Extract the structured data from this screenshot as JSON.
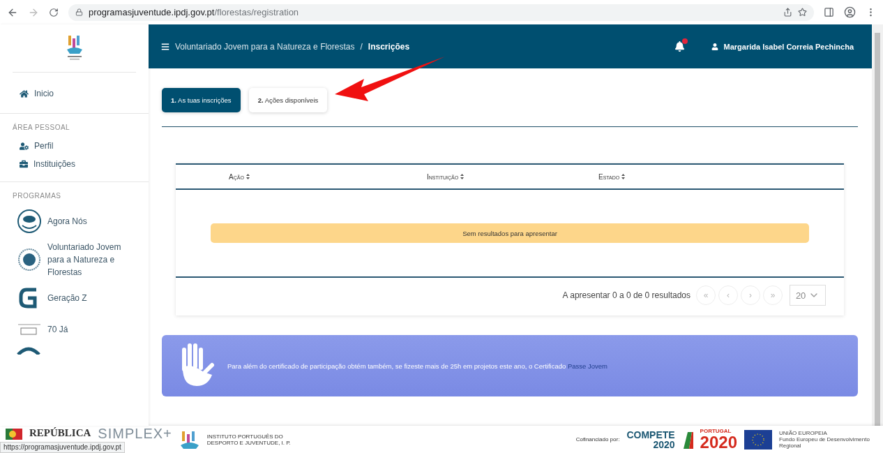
{
  "browser": {
    "url_host": "programasjuventude.ipdj.gov.pt",
    "url_path": "/florestas/registration"
  },
  "sidebar": {
    "home": {
      "label": "Inicio"
    },
    "sections": [
      {
        "title": "ÁREA PESSOAL",
        "items": [
          {
            "label": "Perfil",
            "kind": "profile"
          },
          {
            "label": "Instituições",
            "kind": "briefcase"
          }
        ]
      },
      {
        "title": "PROGRAMAS",
        "items": [
          {
            "label": "Agora Nós",
            "kind": "nos"
          },
          {
            "label": "Voluntariado Jovem para a Natureza e Florestas",
            "kind": "vjnf"
          },
          {
            "label": "Geração Z",
            "kind": "geracao"
          },
          {
            "label": "70 Já",
            "kind": "setenta"
          }
        ]
      }
    ]
  },
  "header": {
    "separator": "/",
    "breadcrumb": [
      {
        "label": "Voluntariado Jovem para a Natureza e Florestas",
        "current": false
      },
      {
        "label": "Inscrições",
        "current": true
      }
    ],
    "user": "Margarida Isabel Correia Pechincha"
  },
  "tabs": [
    {
      "number": "1.",
      "label": "As tuas inscrições",
      "selected": true
    },
    {
      "number": "2.",
      "label": "Ações disponíveis",
      "selected": false
    }
  ],
  "table": {
    "columns": [
      "Ação",
      "Instituição",
      "Estado"
    ],
    "empty_message": "Sem resultados para apresentar",
    "summary": "A apresentar 0 a 0 de 0 resultados",
    "pager": [
      "«",
      "‹",
      "›",
      "»"
    ],
    "page_size": "20"
  },
  "banner": {
    "text": "Para além do certificado de participação obtém também, se fizeste mais de 25h em projetos este ano, o Certificado",
    "link": "Passe Jovem"
  },
  "footer": {
    "republica": "REPÚBLICA",
    "simplex": "SIMPLEX+",
    "ipdj": "INSTITUTO PORTUGUÊS DO DESPORTO E JUVENTUDE, I. P.",
    "cofinanciado": "Cofinanciado por:",
    "compete": "COMPETE",
    "compete_year": "2020",
    "portugal": "PORTUGAL",
    "portugal_year": "2020",
    "ue": "UNIÃO EUROPEIA",
    "fundo": "Fundo Europeu de Desenvolvimento Regional"
  },
  "status_url": "https://programasjuventude.ipdj.gov.pt"
}
